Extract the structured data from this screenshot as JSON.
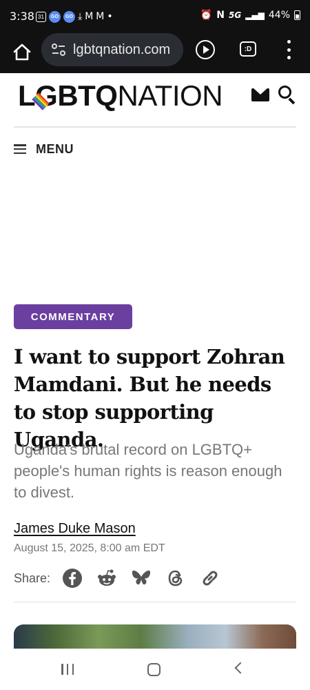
{
  "status_bar": {
    "time": "3:38",
    "left_icons": [
      "calendar-31-icon",
      "go-icon",
      "go-icon",
      "download-icon",
      "gmail-icon",
      "gmail-icon",
      "dot-icon"
    ],
    "calendar_day": "31",
    "go_label": "GO",
    "download_glyph": "⤓",
    "mail_glyph": "M",
    "dot_glyph": "•",
    "network": "5G",
    "battery": "44%"
  },
  "browser": {
    "url": "lgbtqnation.com",
    "tab_label": ":D"
  },
  "site": {
    "logo_bold": "LGBTQ",
    "logo_light": "NATION",
    "menu_label": "MENU"
  },
  "article": {
    "category": "COMMENTARY",
    "headline": "I want to support Zohran Mamdani. But he needs to stop supporting Uganda.",
    "dek": "Uganda's brutal record on LGBTQ+ people's human rights is reason enough to divest.",
    "author": "James Duke Mason",
    "date": "August 15, 2025, 8:00 am EDT",
    "share_label": "Share:",
    "share_icons": [
      "facebook-icon",
      "reddit-icon",
      "bluesky-icon",
      "threads-icon",
      "link-icon"
    ]
  },
  "colors": {
    "badge": "#6a3fa0",
    "dark_bar": "#111111",
    "url_pill": "#2b2d35"
  }
}
